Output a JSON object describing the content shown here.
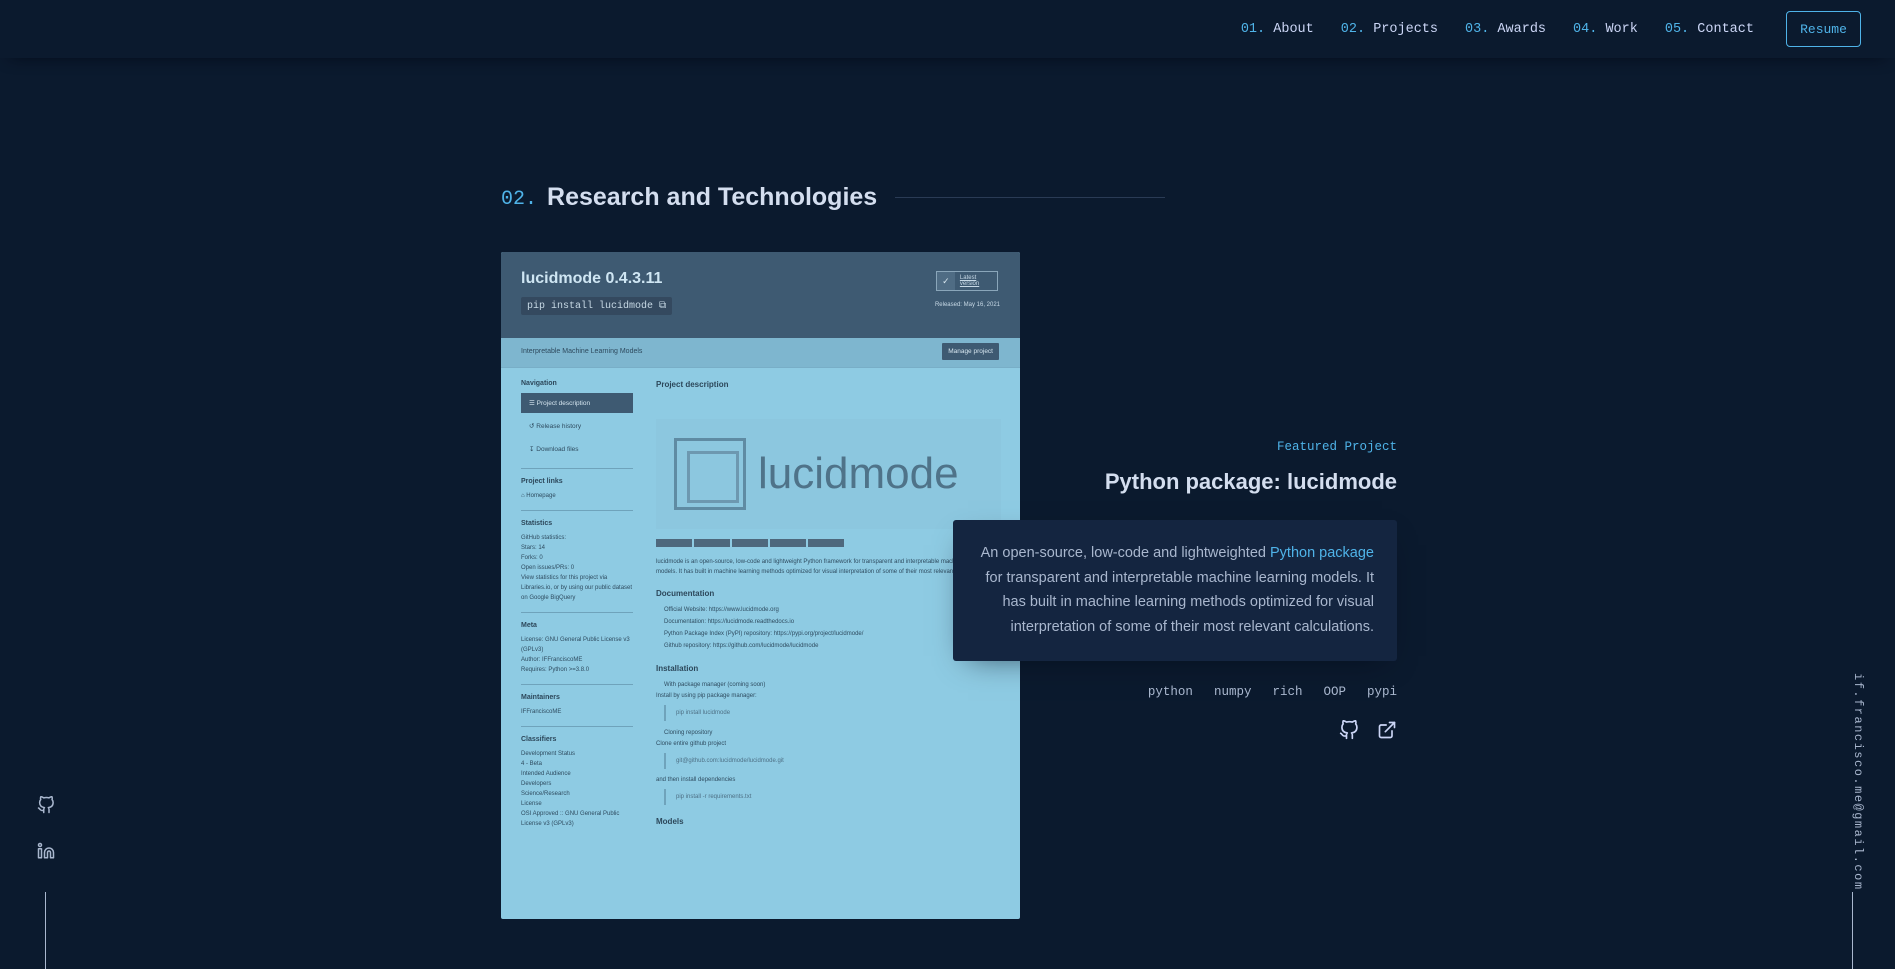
{
  "nav": {
    "items": [
      {
        "num": "01.",
        "label": "About"
      },
      {
        "num": "02.",
        "label": "Projects"
      },
      {
        "num": "03.",
        "label": "Awards"
      },
      {
        "num": "04.",
        "label": "Work"
      },
      {
        "num": "05.",
        "label": "Contact"
      }
    ],
    "resume_label": "Resume"
  },
  "section": {
    "num": "02.",
    "title": "Research and Technologies"
  },
  "project": {
    "overline": "Featured Project",
    "title": "Python package: lucidmode",
    "description_before": "An open-source, low-code and lightweighted ",
    "description_link": "Python package",
    "description_after": " for transparent and interpretable machine learning models. It has built in machine learning methods optimized for visual interpretation of some of their most relevant calculations.",
    "tech": [
      "python",
      "numpy",
      "rich",
      "OOP",
      "pypi"
    ],
    "links": [
      "github-icon",
      "external-link-icon"
    ]
  },
  "screenshot": {
    "title": "lucidmode 0.4.3.11",
    "pip": "pip install lucidmode",
    "latest": "Latest version",
    "released": "Released: May 16, 2021",
    "tagline": "Interpretable Machine Learning Models",
    "manage": "Manage project",
    "nav_heading": "Navigation",
    "nav_items": [
      "Project description",
      "Release history",
      "Download files"
    ],
    "links_heading": "Project links",
    "homepage": "Homepage",
    "stats_heading": "Statistics",
    "github_stats": "GitHub statistics:",
    "stars": "Stars: 14",
    "forks": "Forks: 0",
    "issues": "Open issues/PRs: 0",
    "stats_note": "View statistics for this project via Libraries.io, or by using our public dataset on Google BigQuery",
    "meta_heading": "Meta",
    "license": "License: GNU General Public License v3 (GPLv3)",
    "author": "Author: IFFranciscoME",
    "requires": "Requires: Python >=3.8.0",
    "maintainers_heading": "Maintainers",
    "maintainer": "IFFranciscoME",
    "classifiers_heading": "Classifiers",
    "dev_status": "Development Status",
    "dev_status_val": "4 - Beta",
    "audience": "Intended Audience",
    "audience_vals": [
      "Developers",
      "Science/Research"
    ],
    "license_heading": "License",
    "license_val": "OSI Approved :: GNU General Public License v3 (GPLv3)",
    "desc_heading": "Project description",
    "logo_word": "lucidmode",
    "intro": "lucidmode is an open-source, low-code and lightweight Python framework for transparent and interpretable machine learning models. It has built in machine learning methods optimized for visual interpretation of some of their most relevant calculations.",
    "doc_heading": "Documentation",
    "doc_items": [
      "Official Website: https://www.lucidmode.org",
      "Documentation: https://lucidmode.readthedocs.io",
      "Python Package Index (PyPI) repository: https://pypi.org/project/lucidmode/",
      "Github repository: https://github.com/lucidmode/lucidmode"
    ],
    "install_heading": "Installation",
    "install_1": "With package manager (coming soon)",
    "install_pip_note": "Install by using pip package manager:",
    "install_pip_code": "pip install lucidmode",
    "install_2": "Cloning repository",
    "install_clone_note": "Clone entire github project",
    "install_clone_code": "git@github.com:lucidmode/lucidmode.git",
    "install_deps_note": "and then install dependencies",
    "install_deps_code": "pip install -r requirements.txt",
    "models_heading": "Models"
  },
  "sidebar": {
    "email": "if.francisco.me@gmail.com"
  },
  "colors": {
    "background": "#0b1a2e",
    "accent": "#4fb3e8",
    "card": "#142540",
    "text": "#ccd6f6"
  }
}
